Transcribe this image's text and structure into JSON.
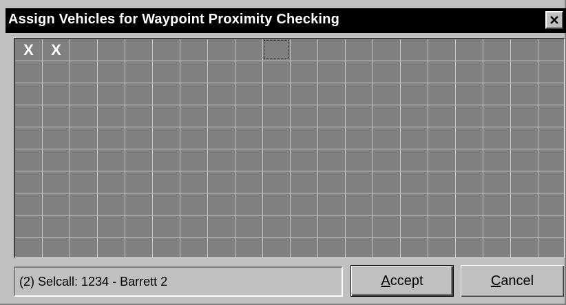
{
  "window": {
    "title": "Assign Vehicles for Waypoint Proximity Checking",
    "close_glyph": "✕"
  },
  "grid": {
    "columns": 20,
    "rows": 10,
    "check_glyph": "X",
    "checked_cells": [
      0,
      1
    ],
    "focused_cell": 9,
    "colors": {
      "cell_bg": "#808080",
      "grid_line": "#c8c8c8",
      "mark": "#ffffff"
    }
  },
  "status": {
    "text": "(2) Selcall: 1234 - Barrett 2"
  },
  "buttons": {
    "accept": {
      "mnemonic": "A",
      "rest": "ccept"
    },
    "cancel": {
      "mnemonic": "C",
      "rest": "ancel"
    }
  }
}
